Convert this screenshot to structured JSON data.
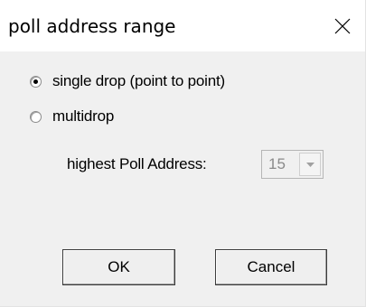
{
  "window": {
    "title": "poll address range",
    "close_icon": "close-icon"
  },
  "options": {
    "single_drop": {
      "label": "single drop (point to point)",
      "checked": true
    },
    "multidrop": {
      "label": "multidrop",
      "checked": false
    }
  },
  "poll": {
    "label": "highest Poll Address:",
    "value": "15",
    "enabled": false,
    "dropdown_icon": "chevron-down-icon"
  },
  "buttons": {
    "ok_label": "OK",
    "cancel_label": "Cancel"
  },
  "colors": {
    "dialog_bg": "#f0f0f0",
    "title_bg": "#ffffff",
    "disabled_text": "#8a8a8a"
  }
}
